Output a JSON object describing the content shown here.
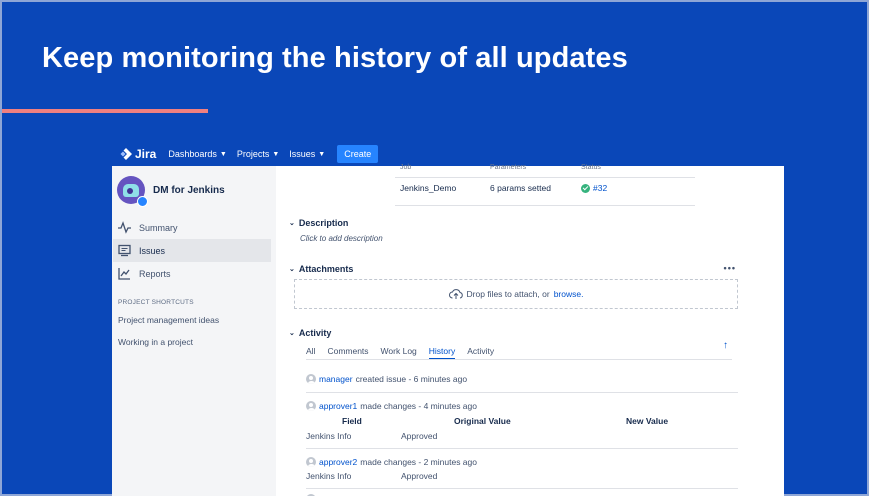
{
  "slide": {
    "title": "Keep monitoring the history of all updates",
    "background_color": "#0a47b8",
    "accent_color": "#f08080"
  },
  "topnav": {
    "logo": "Jira",
    "items": [
      "Dashboards",
      "Projects",
      "Issues"
    ],
    "create_label": "Create"
  },
  "sidebar": {
    "project_name": "DM for Jenkins",
    "items": [
      {
        "label": "Summary",
        "icon": "pulse-icon"
      },
      {
        "label": "Issues",
        "icon": "issues-icon",
        "active": true
      },
      {
        "label": "Reports",
        "icon": "chart-icon"
      }
    ],
    "shortcuts_heading": "PROJECT SHORTCUTS",
    "shortcuts": [
      "Project management ideas",
      "Working in a project"
    ]
  },
  "job_table": {
    "headers": [
      "Job",
      "Parameters",
      "Status"
    ],
    "row": {
      "job": "Jenkins_Demo",
      "parameters": "6 params setted",
      "status": "#32"
    }
  },
  "description": {
    "heading": "Description",
    "placeholder": "Click to add description"
  },
  "attachments": {
    "heading": "Attachments",
    "more": "•••",
    "drop_text": "Drop files to attach, or",
    "browse_link": "browse."
  },
  "activity": {
    "heading": "Activity",
    "tabs": [
      "All",
      "Comments",
      "Work Log",
      "History",
      "Activity"
    ],
    "active_tab": "History",
    "sort_icon": "↑",
    "entries": [
      {
        "user": "manager",
        "action": "created issue - 6 minutes ago"
      },
      {
        "user": "approver1",
        "action": "made changes - 4 minutes ago"
      },
      {
        "user": "approver2",
        "action": "made changes - 2 minutes ago"
      }
    ],
    "change_headers": {
      "field": "Field",
      "original": "Original Value",
      "new": "New Value"
    },
    "changes": [
      {
        "field": "Jenkins Info",
        "original": "Approved"
      },
      {
        "field": "Jenkins Info",
        "original": "Approved"
      }
    ]
  }
}
